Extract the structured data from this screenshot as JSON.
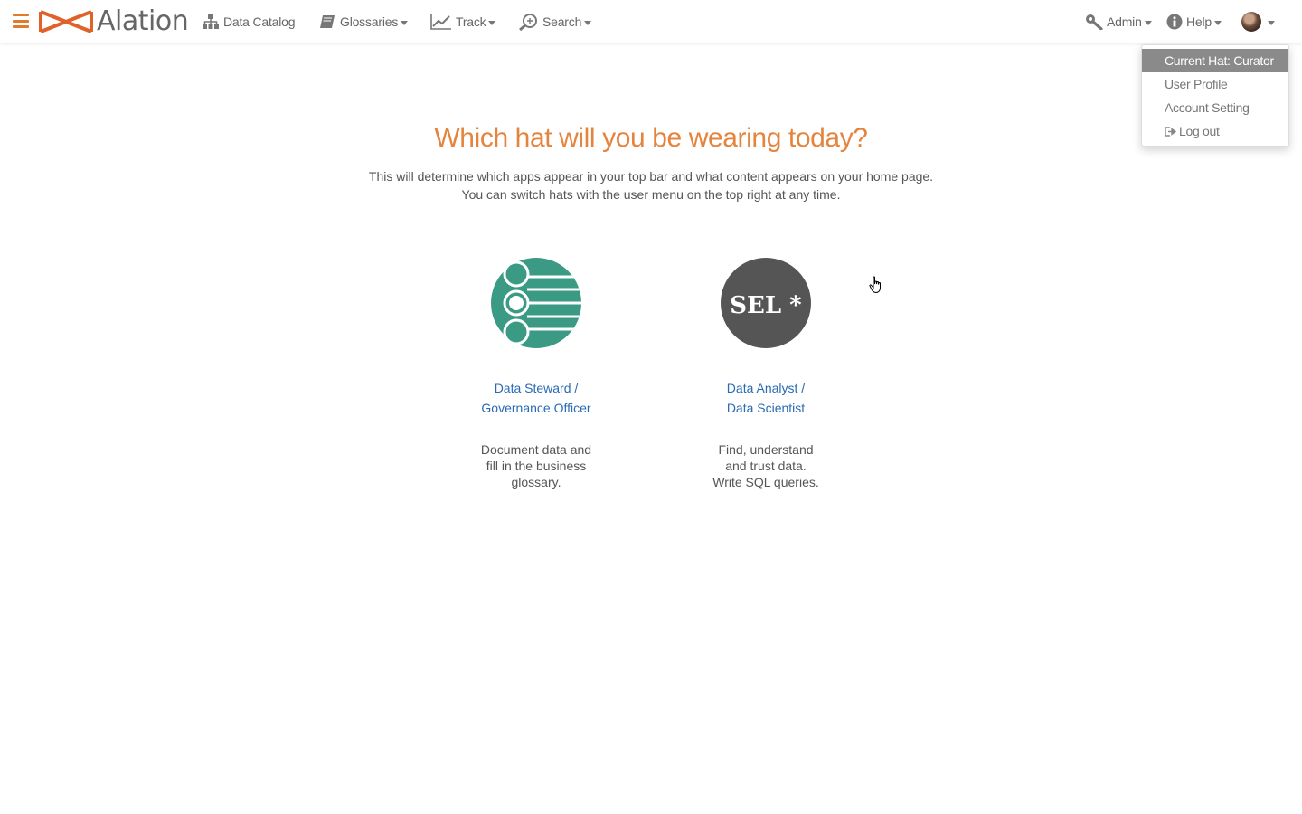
{
  "navbar": {
    "brand": "Alation",
    "items": [
      {
        "label": "Data Catalog",
        "icon": "sitemap-icon",
        "has_caret": false
      },
      {
        "label": "Glossaries",
        "icon": "book-icon",
        "has_caret": true
      },
      {
        "label": "Track",
        "icon": "line-chart-icon",
        "has_caret": true
      },
      {
        "label": "Search",
        "icon": "search-icon",
        "has_caret": true
      }
    ],
    "right": [
      {
        "label": "Admin",
        "icon": "wrench-icon",
        "has_caret": true
      },
      {
        "label": "Help",
        "icon": "info-icon",
        "has_caret": true
      }
    ],
    "accent_color": "#e07b2a"
  },
  "user_menu": {
    "items": [
      {
        "label": "Current Hat: Curator",
        "active": true
      },
      {
        "label": "User Profile",
        "active": false
      },
      {
        "label": "Account Setting",
        "active": false
      },
      {
        "label": "Log out",
        "active": false,
        "icon": "logout-icon"
      }
    ]
  },
  "main": {
    "headline": "Which hat will you be wearing today?",
    "subtitle_line1": "This will determine which apps appear in your top bar and what content appears on your home page.",
    "subtitle_line2": "You can switch hats with the user menu on the top right at any time.",
    "hats": [
      {
        "title_line1": "Data Steward /",
        "title_line2": "Governance Officer",
        "desc_line1": "Document data and",
        "desc_line2": "fill in the business",
        "desc_line3": "glossary.",
        "icon": "steward-icon",
        "color": "#3b9a84"
      },
      {
        "title_line1": "Data Analyst /",
        "title_line2": "Data Scientist",
        "desc_line1": "Find, understand",
        "desc_line2": "and trust data.",
        "desc_line3": "Write SQL queries.",
        "icon": "sql-icon",
        "icon_text": "SEL *",
        "color": "#555555"
      }
    ]
  }
}
